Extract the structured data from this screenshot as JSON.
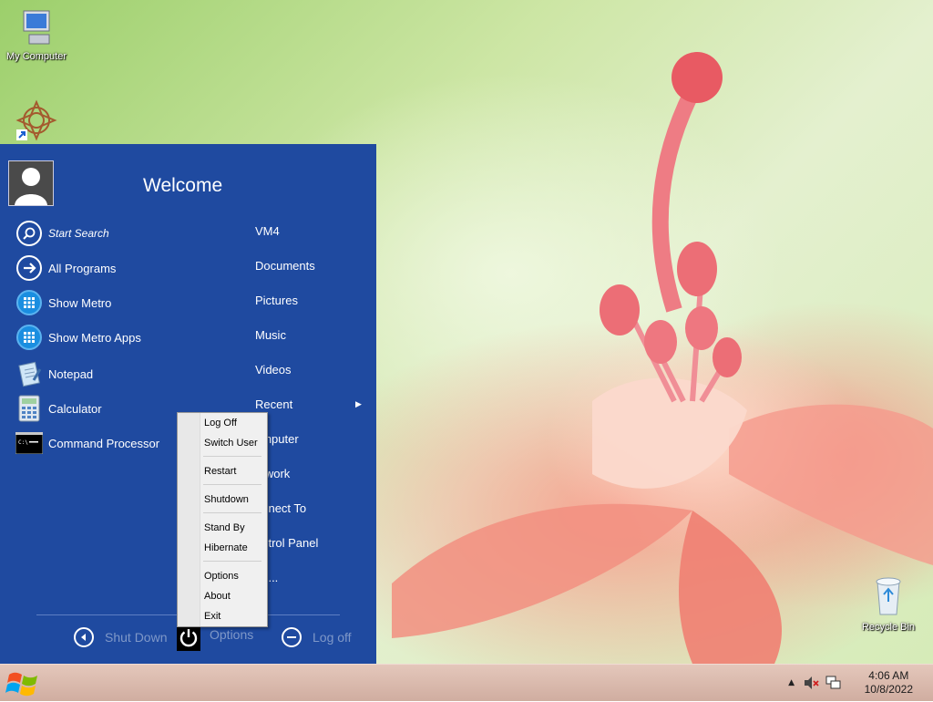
{
  "desktop": {
    "icons": [
      {
        "label": "My Computer",
        "icon": "my-computer-icon"
      },
      {
        "label": "",
        "icon": "mandala-shortcut-icon"
      },
      {
        "label": "Recycle Bin",
        "icon": "recycle-bin-icon"
      }
    ]
  },
  "start_menu": {
    "welcome": "Welcome",
    "left_items": [
      {
        "label": "Start Search",
        "icon": "search-icon"
      },
      {
        "label": "All Programs",
        "icon": "arrow-right-icon"
      },
      {
        "label": "Show Metro",
        "icon": "metro-grid-icon"
      },
      {
        "label": "Show Metro Apps",
        "icon": "metro-grid-icon"
      },
      {
        "label": "Notepad",
        "icon": "notepad-icon"
      },
      {
        "label": "Calculator",
        "icon": "calculator-icon"
      },
      {
        "label": "Command Processor",
        "icon": "command-prompt-icon"
      }
    ],
    "right_items": [
      {
        "label": "VM4"
      },
      {
        "label": "Documents"
      },
      {
        "label": "Pictures"
      },
      {
        "label": "Music"
      },
      {
        "label": "Videos"
      },
      {
        "label": "Recent"
      },
      {
        "label": "omputer"
      },
      {
        "label": "etwork"
      },
      {
        "label": "onnect To"
      },
      {
        "label": "ontrol Panel"
      },
      {
        "label": "un..."
      }
    ],
    "bottom": {
      "shutdown": "Shut Down",
      "options": "Options",
      "logoff": "Log off"
    }
  },
  "context_menu": {
    "items": [
      "Log Off",
      "Switch User",
      "Restart",
      "Shutdown",
      "Stand By",
      "Hibernate",
      "Options",
      "About",
      "Exit"
    ]
  },
  "taskbar": {
    "time": "4:06 AM",
    "date": "10/8/2022"
  },
  "colors": {
    "start_menu_bg": "#1f4aa0",
    "taskbar_bg": "#d9b8ab"
  }
}
